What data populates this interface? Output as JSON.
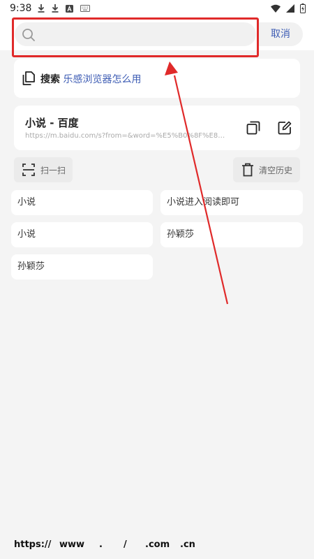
{
  "status_bar": {
    "time": "9:38",
    "left_icons": [
      "download-icon",
      "download-icon",
      "a-box-icon",
      "keyboard-icon"
    ],
    "right_icons": [
      "wifi-icon",
      "signal-icon",
      "battery-charging-icon"
    ]
  },
  "search": {
    "placeholder": "",
    "value": "",
    "cancel_label": "取消"
  },
  "tip": {
    "prefix": "搜索",
    "link": "乐感浏览器怎么用"
  },
  "history_card": {
    "title": "小说 - 百度",
    "url": "https://m.baidu.com/s?from=&word=%E5%B0%8F%E8%AF..."
  },
  "actions": {
    "scan_label": "扫一扫",
    "clear_label": "清空历史"
  },
  "history_chips": [
    "小说",
    "小说进入阅读即可",
    "小说",
    "孙颖莎",
    "孙颖莎"
  ],
  "quick_insert": [
    "https://",
    "www",
    ".",
    "/",
    ".com",
    ".cn"
  ],
  "colors": {
    "accent": "#3e5db4",
    "annotation": "#e02a2a",
    "background": "#f4f4f4"
  }
}
